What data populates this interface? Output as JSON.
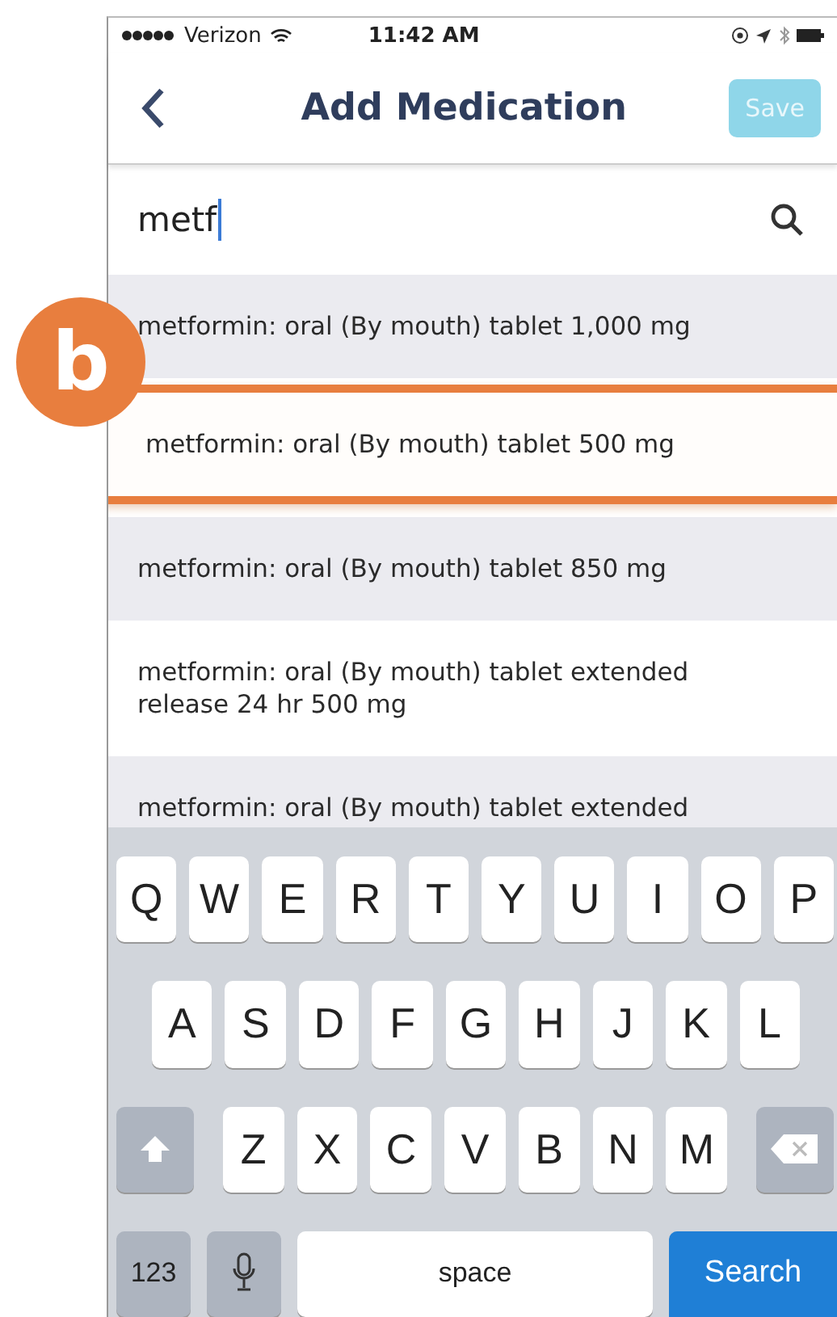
{
  "status_bar": {
    "carrier": "Verizon",
    "time": "11:42 AM"
  },
  "nav": {
    "title": "Add Medication",
    "save": {
      "label": "Save",
      "disabled": true
    }
  },
  "search": {
    "value": "metf"
  },
  "results": [
    {
      "text": "metformin: oral (By mouth) tablet 1,000 mg",
      "selected": false
    },
    {
      "text": "metformin: oral (By mouth) tablet 500 mg",
      "selected": true
    },
    {
      "text": "metformin: oral (By mouth) tablet 850 mg",
      "selected": false
    },
    {
      "text": "metformin: oral (By mouth) tablet extended release 24 hr 500 mg",
      "selected": false
    },
    {
      "text": "metformin: oral (By mouth) tablet extended",
      "selected": false
    }
  ],
  "callout": {
    "label": "b"
  },
  "keyboard": {
    "rows": [
      [
        "Q",
        "W",
        "E",
        "R",
        "T",
        "Y",
        "U",
        "I",
        "O",
        "P"
      ],
      [
        "A",
        "S",
        "D",
        "F",
        "G",
        "H",
        "J",
        "K",
        "L"
      ],
      [
        "Z",
        "X",
        "C",
        "V",
        "B",
        "N",
        "M"
      ]
    ],
    "numbers": "123",
    "space": "space",
    "action": "Search"
  }
}
